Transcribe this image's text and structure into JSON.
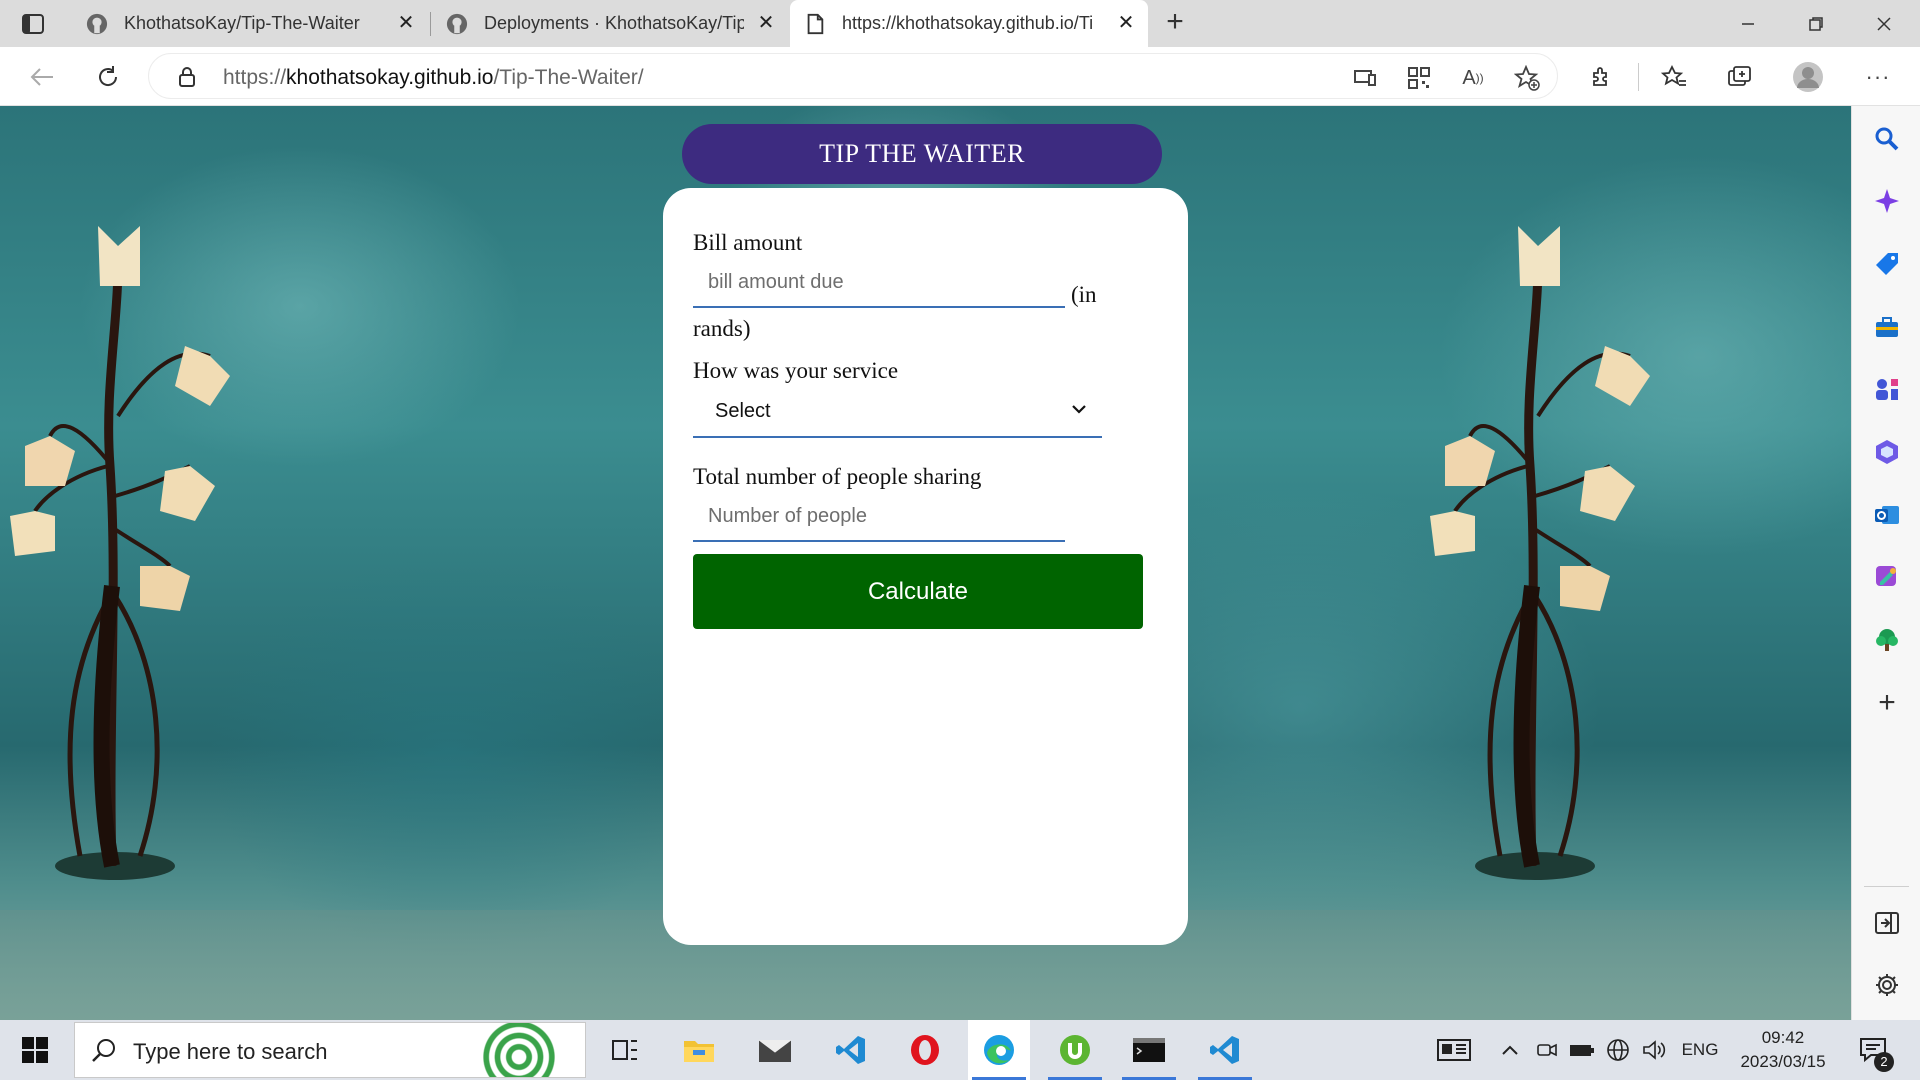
{
  "browser": {
    "tabs": [
      {
        "title": "KhothatsoKay/Tip-The-Waiter",
        "favicon": "github-icon",
        "active": false
      },
      {
        "title": "Deployments · KhothatsoKay/Tip",
        "favicon": "github-icon",
        "active": false
      },
      {
        "title": "https://khothatsokay.github.io/Ti",
        "favicon": "page-icon",
        "active": true
      }
    ],
    "address": {
      "scheme": "https://",
      "host": "khothatsokay.github.io",
      "path": "/Tip-The-Waiter/"
    }
  },
  "page": {
    "title": "TIP THE WAITER",
    "bill_label": "Bill amount",
    "bill_placeholder": "bill amount due",
    "bill_suffix_1": "(in",
    "bill_suffix_2": "rands)",
    "service_label": "How was your service",
    "service_selected": "Select",
    "people_label": "Total number of people sharing",
    "people_placeholder": "Number of people",
    "calculate_label": "Calculate"
  },
  "taskbar": {
    "search_placeholder": "Type here to search",
    "language": "ENG",
    "time": "09:42",
    "date": "2023/03/15",
    "notification_count": "2"
  },
  "colors": {
    "title_pill": "#3d2b80",
    "calculate_button": "#006400",
    "field_underline": "#3a6fb5"
  }
}
